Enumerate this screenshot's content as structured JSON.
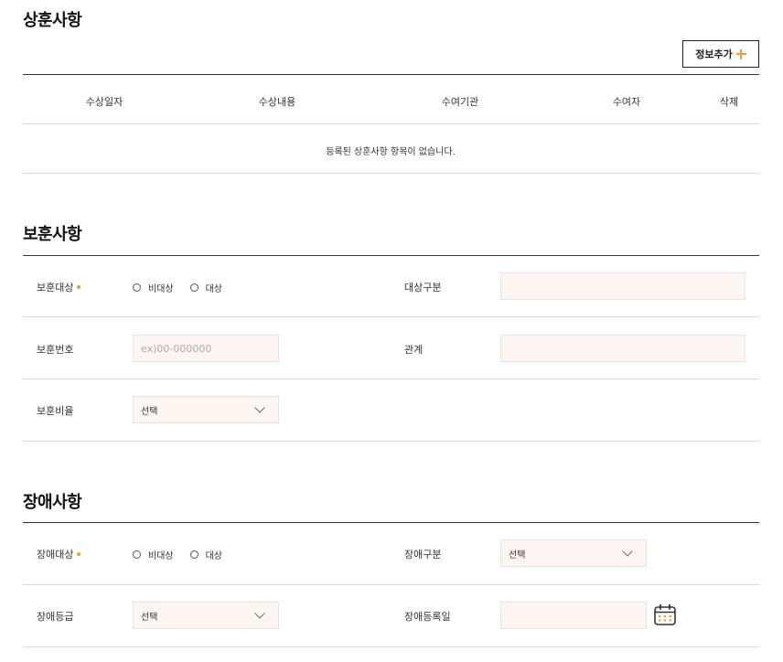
{
  "awards": {
    "title": "상훈사항",
    "add_button": "정보추가",
    "columns": [
      "수상일자",
      "수상내용",
      "수여기관",
      "수여자",
      "삭제"
    ],
    "empty_message": "등록된 상훈사항 항목이 없습니다."
  },
  "veteran": {
    "title": "보훈사항",
    "target_label": "보훈대상",
    "target_options": [
      "비대상",
      "대상"
    ],
    "category_label": "대상구분",
    "category_value": "",
    "number_label": "보훈번호",
    "number_placeholder": "ex)00-000000",
    "relation_label": "관계",
    "relation_value": "",
    "ratio_label": "보훈비율",
    "ratio_selected": "선택"
  },
  "disability": {
    "title": "장애사항",
    "target_label": "장애대상",
    "target_options": [
      "비대상",
      "대상"
    ],
    "type_label": "장애구분",
    "type_selected": "선택",
    "grade_label": "장애등급",
    "grade_selected": "선택",
    "reg_date_label": "장애등록일",
    "reg_date_value": ""
  },
  "colors": {
    "accent": "#f39c32",
    "input_bg": "#fdf6f0",
    "rule_dark": "#333333",
    "rule_light": "#d9d9d9"
  },
  "icons": {
    "add": "plus-icon",
    "dropdown": "chevron-down-icon",
    "date": "calendar-icon"
  }
}
